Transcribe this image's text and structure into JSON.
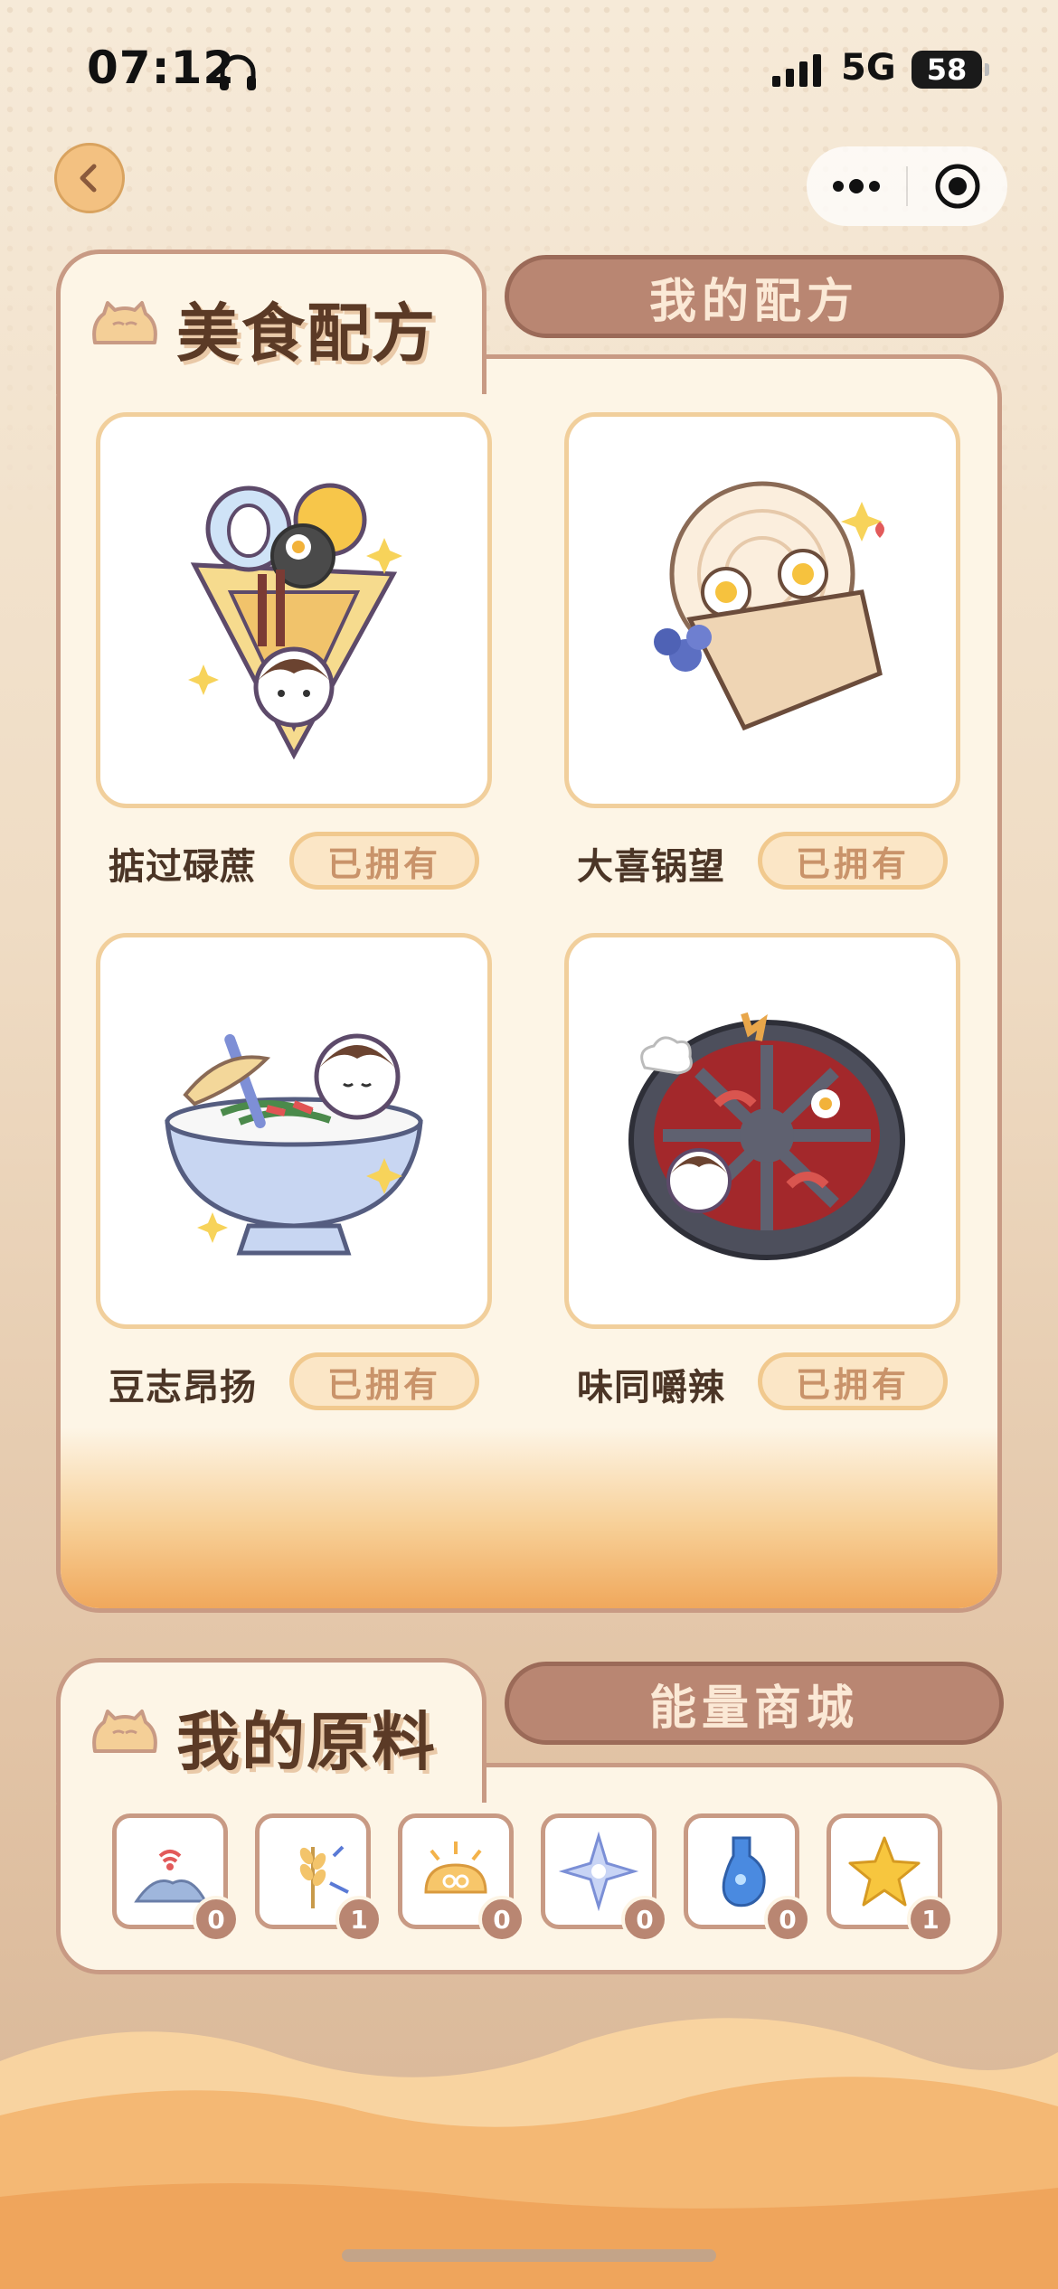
{
  "status_bar": {
    "time": "07:12",
    "network": "5G",
    "battery": "58"
  },
  "nav": {
    "back_icon": "chevron-left-icon",
    "more_icon": "more-dots-icon",
    "target_icon": "record-target-icon"
  },
  "recipes_section": {
    "title": "美食配方",
    "tab_other": "我的配方",
    "items": [
      {
        "name": "掂过碌蔗",
        "status": "已拥有",
        "icon": "bouquet-food-icon"
      },
      {
        "name": "大喜锅望",
        "status": "已拥有",
        "icon": "egg-pancake-icon"
      },
      {
        "name": "豆志昂扬",
        "status": "已拥有",
        "icon": "noodle-bowl-icon"
      },
      {
        "name": "味同嚼辣",
        "status": "已拥有",
        "icon": "hotpot-icon"
      }
    ]
  },
  "ingredients_section": {
    "title": "我的原料",
    "tab_other": "能量商城",
    "items": [
      {
        "icon": "flour-signal-icon",
        "count": "0"
      },
      {
        "icon": "wheat-icon",
        "count": "1"
      },
      {
        "icon": "sun-bun-icon",
        "count": "0"
      },
      {
        "icon": "snowflake-star-icon",
        "count": "0"
      },
      {
        "icon": "blue-bottle-icon",
        "count": "0"
      },
      {
        "icon": "gold-star-icon",
        "count": "1"
      }
    ]
  },
  "colors": {
    "accent": "#b98672",
    "panel": "#fdf5e6",
    "border": "#c89a84",
    "owned_bg": "#fbe6c6"
  }
}
